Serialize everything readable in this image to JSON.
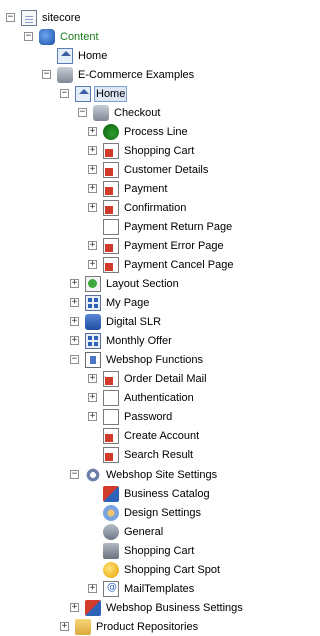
{
  "tree": {
    "sitecore": "sitecore",
    "content": "Content",
    "home_top": "Home",
    "ecommerce": "E-Commerce Examples",
    "home": "Home",
    "checkout": "Checkout",
    "process_line": "Process Line",
    "shopping_cart": "Shopping Cart",
    "customer_details": "Customer Details",
    "payment": "Payment",
    "confirmation": "Confirmation",
    "payment_return": "Payment Return Page",
    "payment_error": "Payment Error Page",
    "payment_cancel": "Payment Cancel Page",
    "layout_section": "Layout Section",
    "my_page": "My Page",
    "digital_slr": "Digital SLR",
    "monthly_offer": "Monthly Offer",
    "webshop_functions": "Webshop Functions",
    "order_detail_mail": "Order Detail Mail",
    "authentication": "Authentication",
    "password": "Password",
    "create_account": "Create Account",
    "search_result": "Search Result",
    "webshop_site_settings": "Webshop Site Settings",
    "business_catalog": "Business Catalog",
    "design_settings": "Design Settings",
    "general": "General",
    "shopping_cart_setting": "Shopping Cart",
    "shopping_cart_spot": "Shopping Cart Spot",
    "mail_templates": "MailTemplates",
    "webshop_business_settings": "Webshop Business Settings",
    "product_repositories": "Product Repositories"
  },
  "expanders": {
    "expanded": "−",
    "collapsed": "+"
  }
}
